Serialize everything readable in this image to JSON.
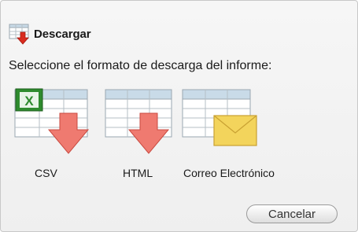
{
  "dialog": {
    "title": "Descargar",
    "title_icon": "table-download-icon",
    "prompt": "Seleccione el formato de descarga del informe:"
  },
  "formats": [
    {
      "label": "CSV",
      "icon": "excel-csv-download-icon"
    },
    {
      "label": "HTML",
      "icon": "table-html-download-icon"
    },
    {
      "label": "Correo Electrónico",
      "icon": "table-email-icon"
    }
  ],
  "buttons": {
    "cancel_label": "Cancelar"
  },
  "colors": {
    "download_arrow": "#e8594d",
    "excel_green": "#2e8b2e",
    "envelope": "#f3d45c",
    "table_header": "#c9dbe8"
  }
}
